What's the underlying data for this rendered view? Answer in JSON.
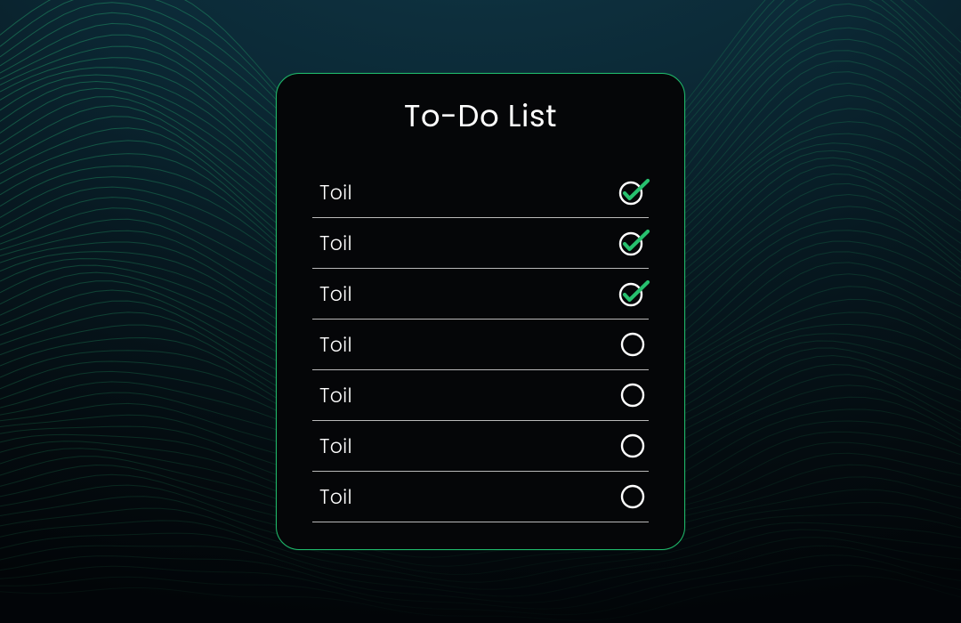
{
  "card": {
    "title": "To-Do List",
    "items": [
      {
        "label": "Toil",
        "checked": true
      },
      {
        "label": "Toil",
        "checked": true
      },
      {
        "label": "Toil",
        "checked": true
      },
      {
        "label": "Toil",
        "checked": false
      },
      {
        "label": "Toil",
        "checked": false
      },
      {
        "label": "Toil",
        "checked": false
      },
      {
        "label": "Toil",
        "checked": false
      }
    ]
  },
  "colors": {
    "accent": "#1fb76a",
    "check": "#27c06e",
    "ring": "#ffffff"
  }
}
